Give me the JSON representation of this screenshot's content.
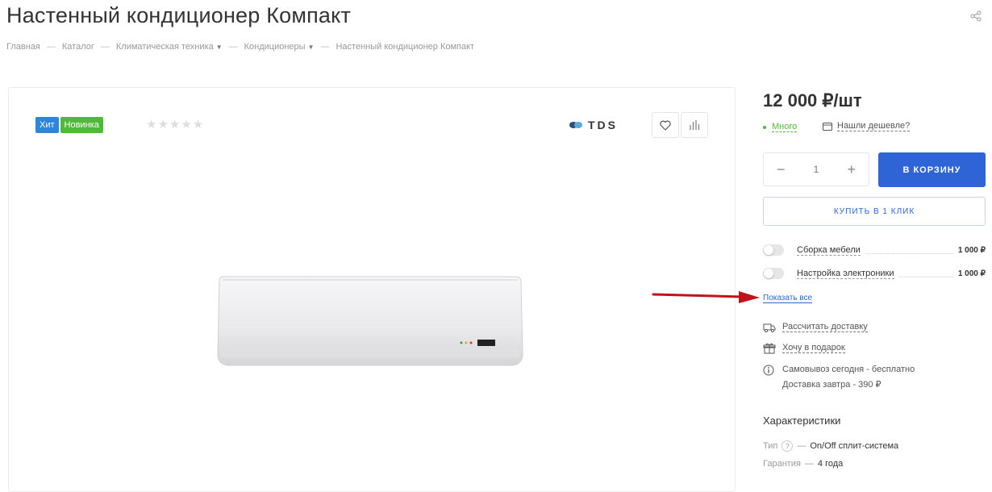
{
  "page": {
    "title": "Настенный кондиционер Компакт"
  },
  "breadcrumb": {
    "separator": "—",
    "items": [
      {
        "label": "Главная"
      },
      {
        "label": "Каталог"
      },
      {
        "label": "Климатическая техника",
        "has_dropdown": true
      },
      {
        "label": "Кондиционеры",
        "has_dropdown": true
      },
      {
        "label": "Настенный кондиционер Компакт"
      }
    ]
  },
  "gallery": {
    "badges": {
      "hit": "Хит",
      "new": "Новинка"
    },
    "rating": {
      "stars_text": "★★★★★",
      "filled": 0,
      "max": 5
    },
    "brand": "TDS",
    "icons": {
      "favorite": "heart-icon",
      "compare": "compare-bars-icon"
    }
  },
  "buy": {
    "price": "12 000 ₽/шт",
    "availability": "Много",
    "cheaper_link": "Нашли дешевле?",
    "quantity": {
      "minus": "−",
      "value": "1",
      "plus": "+"
    },
    "cart_button": "В КОРЗИНУ",
    "one_click_button": "КУПИТЬ В 1 КЛИК"
  },
  "services": [
    {
      "name": "Сборка мебели",
      "price": "1 000 ₽",
      "enabled": false
    },
    {
      "name": "Настройка электроники",
      "price": "1 000 ₽",
      "enabled": false
    }
  ],
  "show_all": "Показать все",
  "info": {
    "calc_delivery": "Рассчитать доставку",
    "gift": "Хочу в подарок",
    "pickup": "Самовывоз сегодня - бесплатно",
    "delivery": "Доставка завтра - 390 ₽"
  },
  "characteristics": {
    "title": "Характеристики",
    "items": [
      {
        "label": "Тип",
        "has_hint": true,
        "hint": "?",
        "sep": "—",
        "value": "On/Off сплит-система"
      },
      {
        "label": "Гарантия",
        "has_hint": false,
        "sep": "—",
        "value": "4 года"
      }
    ]
  },
  "colors": {
    "accent": "#2e64d6",
    "hit_badge": "#2f86d9",
    "new_badge": "#51b83a",
    "availability": "#51b83a",
    "annotation_arrow": "#c0141a"
  }
}
